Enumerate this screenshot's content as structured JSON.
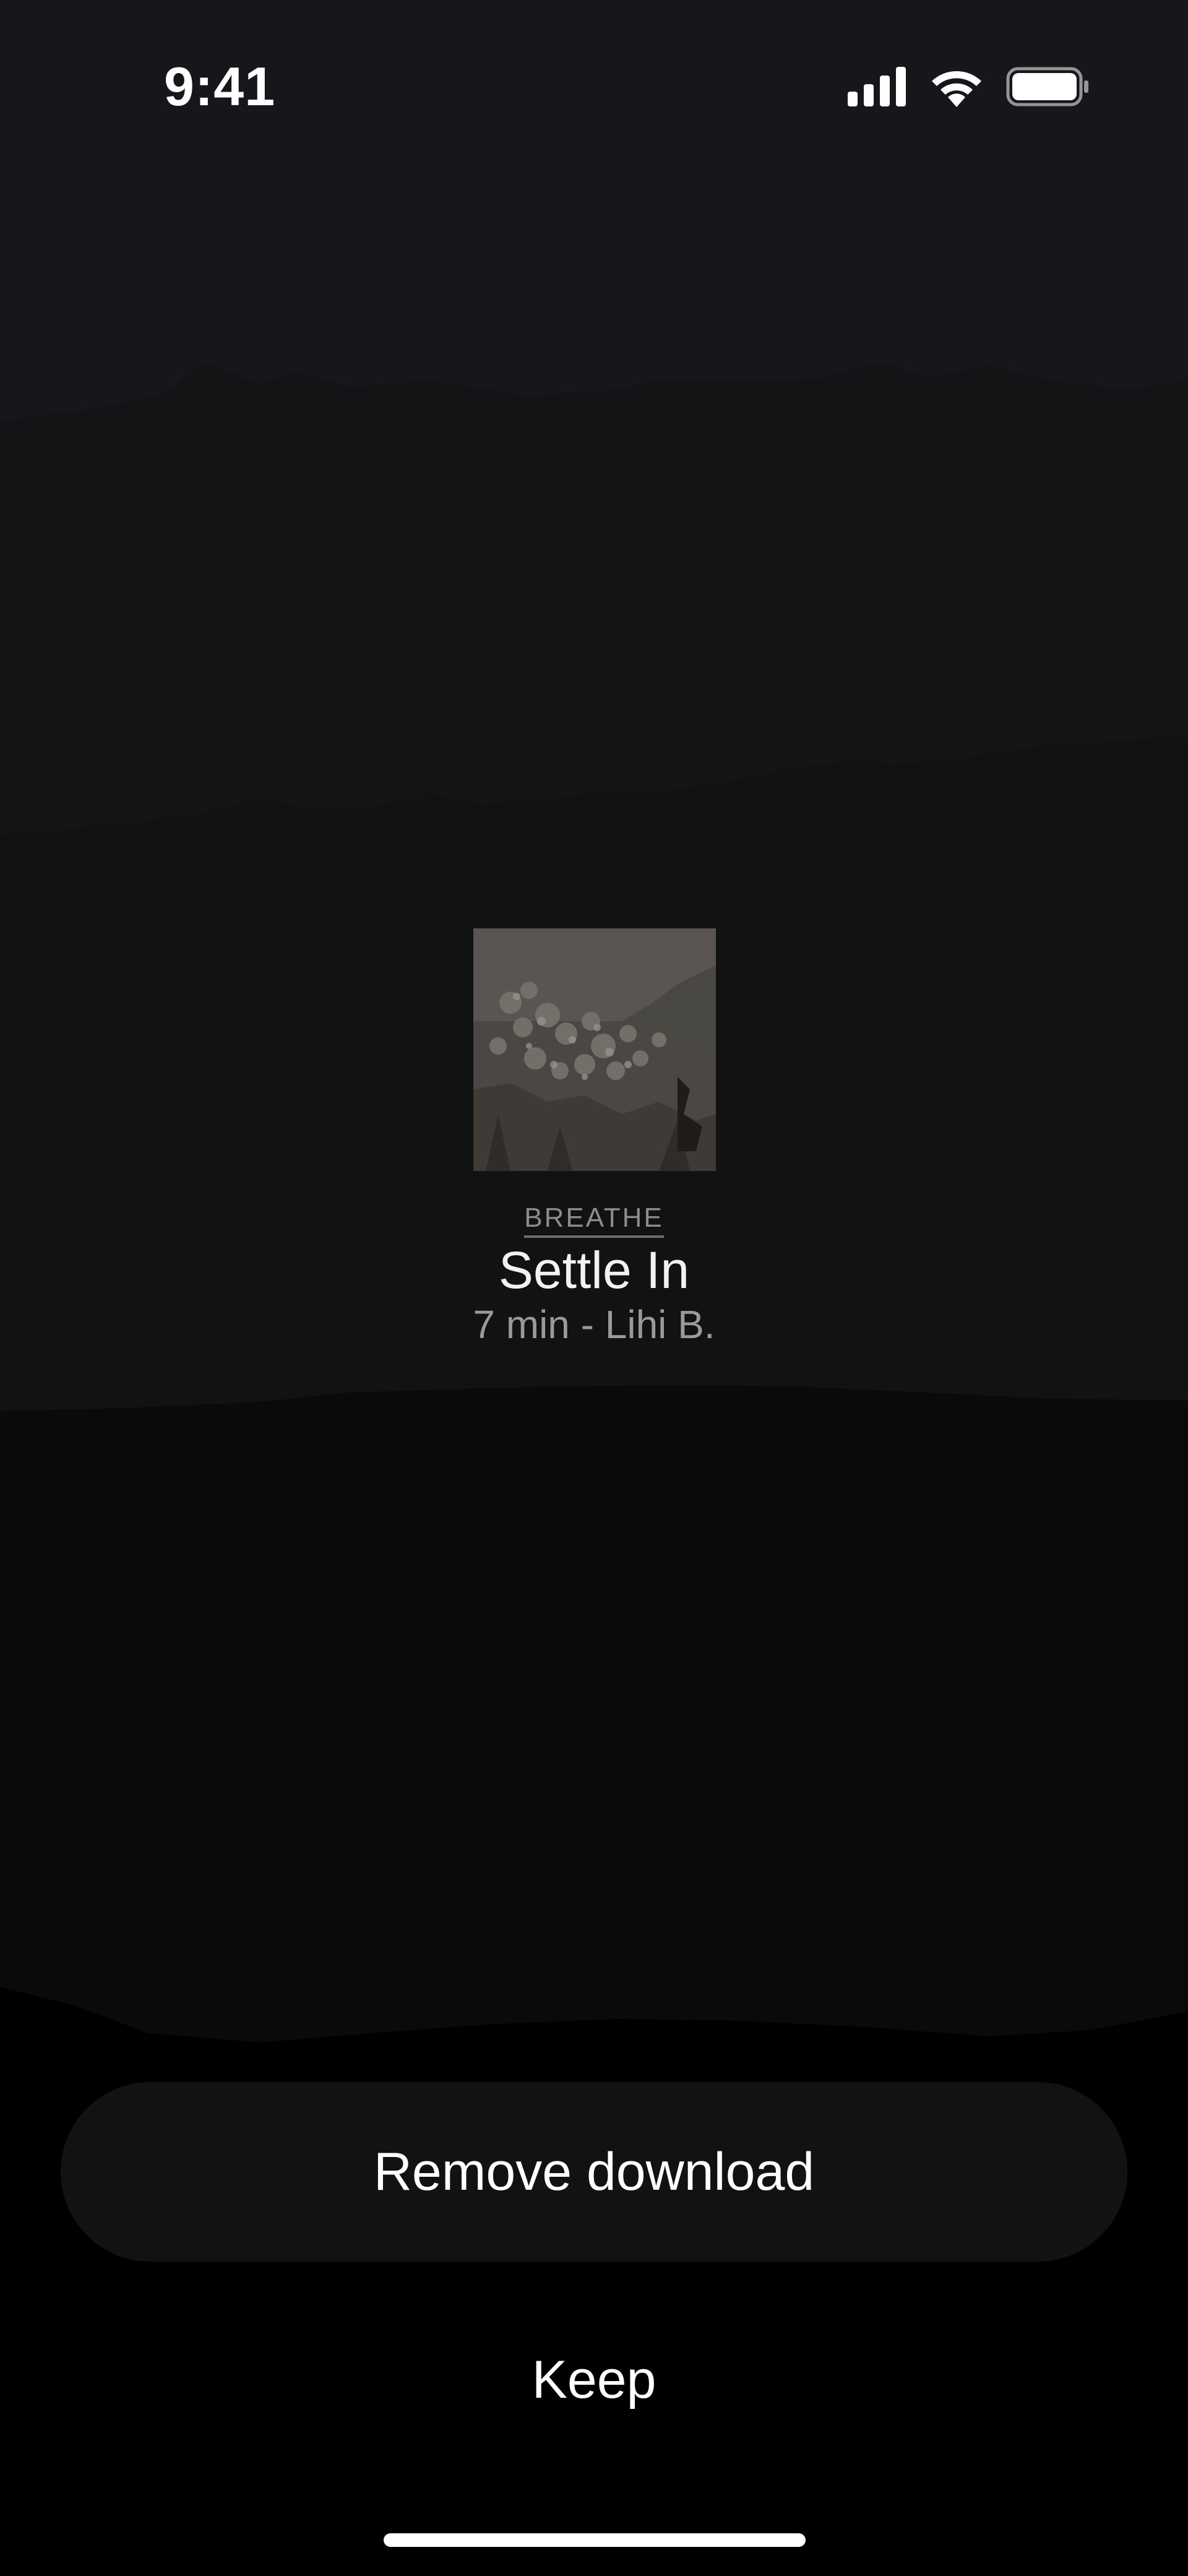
{
  "status_bar": {
    "time": "9:41",
    "icons": [
      "cellular-signal-icon",
      "wifi-icon",
      "battery-icon"
    ]
  },
  "track": {
    "category": "BREATHE",
    "title": "Settle In",
    "meta": "7 min - Lihi B."
  },
  "actions": {
    "primary_label": "Remove download",
    "secondary_label": "Keep"
  },
  "colors": {
    "background_top": "#16171a",
    "background_bottom": "#000000",
    "button_fill": "#111313",
    "text_primary": "#ffffff",
    "text_secondary": "#9a9a9a"
  }
}
